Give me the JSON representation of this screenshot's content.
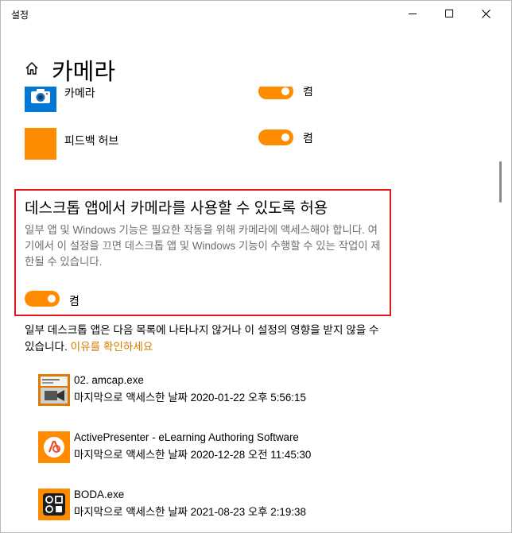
{
  "window": {
    "app_title": "설정",
    "minimize_icon": "minimize-icon",
    "maximize_icon": "maximize-icon",
    "close_icon": "close-icon"
  },
  "header": {
    "home_icon": "home-icon",
    "title": "카메라"
  },
  "store_apps": [
    {
      "name": "카메라",
      "icon": "camera-icon",
      "toggle_label": "켬",
      "toggle_on": true
    },
    {
      "name": "피드백 허브",
      "icon": "feedback-hub-icon",
      "toggle_label": "켬",
      "toggle_on": true
    }
  ],
  "desktop_section": {
    "title": "데스크톱 앱에서 카메라를 사용할 수 있도록 허용",
    "description": "일부 앱 및 Windows 기능은 필요한 작동을 위해 카메라에 액세스해야 합니다. 여기에서 이 설정을 끄면 데스크톱 앱 및 Windows 기능이 수행할 수 있는 작업이 제한될 수 있습니다.",
    "toggle_label": "켬",
    "toggle_on": true
  },
  "note": {
    "text": "일부 데스크톱 앱은 다음 목록에 나타나지 않거나 이 설정의 영향을 받지 않을 수 있습니다.",
    "link": "이유를 확인하세요"
  },
  "desktop_apps": [
    {
      "name": "02. amcap.exe",
      "access": "마지막으로 액세스한 날짜 2020-01-22 오후 5:56:15",
      "icon": "amcap-icon"
    },
    {
      "name": "ActivePresenter - eLearning Authoring Software",
      "access": "마지막으로 액세스한 날짜 2020-12-28 오전 11:45:30",
      "icon": "activepresenter-icon"
    },
    {
      "name": "BODA.exe",
      "access": "마지막으로 액세스한 날짜 2021-08-23 오후 2:19:38",
      "icon": "boda-icon"
    }
  ],
  "colors": {
    "accent": "#ff8c00",
    "highlight_border": "#e11919",
    "link": "#d77b00",
    "secondary_text": "#6d6d6d"
  }
}
